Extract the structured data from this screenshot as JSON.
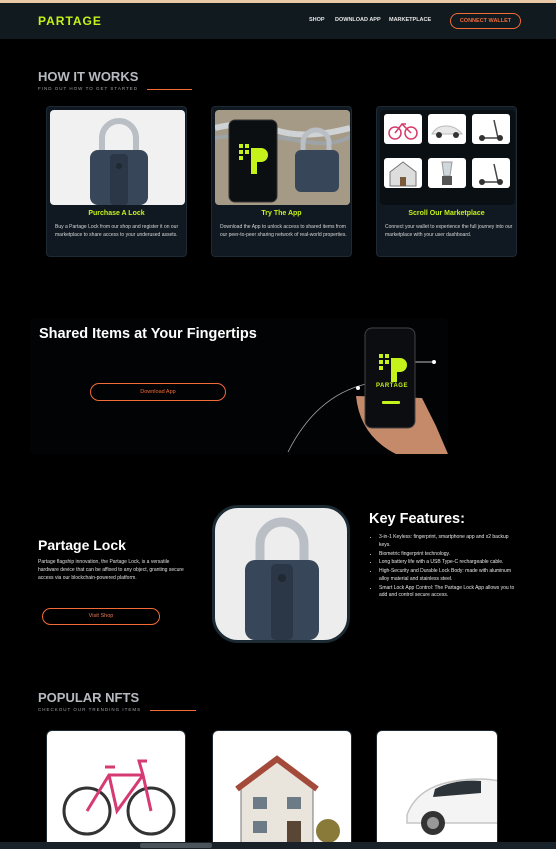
{
  "nav": {
    "logo": "PARTAGE",
    "links": [
      "SHOP",
      "DOWNLOAD APP",
      "MARKETPLACE"
    ],
    "connect_label": "CONNECT WALLET"
  },
  "how_it_works": {
    "title": "HOW IT WORKS",
    "subtitle": "FIND OUT HOW TO GET STARTED",
    "cards": [
      {
        "title": "Purchase A Lock",
        "desc": "Buy a Partage Lock from our shop and register it on our marketplace to share access to your underused assets."
      },
      {
        "title": "Try The App",
        "desc": "Download the App to unlock access to shared items from our peer-to-peer sharing network of real-world properties."
      },
      {
        "title": "Scroll Our Marketplace",
        "desc": "Connect your wallet to experience the full journey into our marketplace with your user dashboard."
      }
    ]
  },
  "app_promo": {
    "title": "Shared Items at Your Fingertips",
    "button": "Download App",
    "phone_brand": "PARTAGE"
  },
  "lock": {
    "title": "Partage Lock",
    "desc": "Partage flagship innovation, the Partage Lock, is a versatile hardware device that can be affixed to any object, granting secure access via our blockchain-powered platform.",
    "button": "Visit Shop",
    "features_title": "Key Features:",
    "features": [
      "3-in-1 Keyless: fingerprint, smartphone app and x2 backup keys.",
      "Biometric fingerprint technology.",
      "Long battery life with a USB Type-C rechargeable cable.",
      "High-Security and Durable Lock Body: made with aluminum alloy material and stainless steel.",
      "Smart Lock App Control: The Partage Lock App allows you to add and control secure access."
    ]
  },
  "nfts": {
    "title": "POPULAR NFTS",
    "subtitle": "CHECKOUT OUR TRENDING ITEMS"
  },
  "colors": {
    "accent": "#c6f21b",
    "orange": "#f26a36",
    "card_bg": "#101921"
  }
}
